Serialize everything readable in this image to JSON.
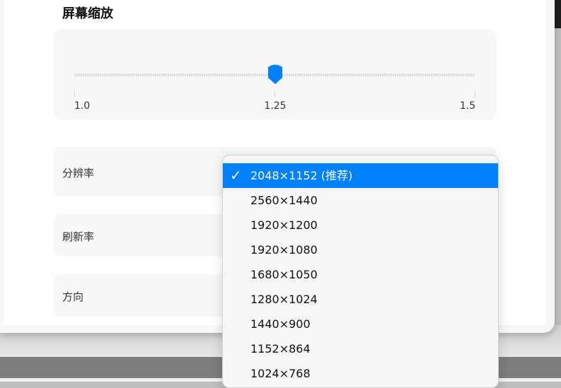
{
  "section_title": "屏幕缩放",
  "scale": {
    "min_label": "1.0",
    "mid_label": "1.25",
    "max_label": "1.5",
    "min": 1.0,
    "max": 1.5,
    "value": 1.25
  },
  "rows": [
    {
      "label": "分辨率"
    },
    {
      "label": "刷新率"
    },
    {
      "label": "方向"
    }
  ],
  "resolution_options": [
    {
      "label": "2048×1152 (推荐)",
      "selected": true
    },
    {
      "label": "2560×1440"
    },
    {
      "label": "1920×1200"
    },
    {
      "label": "1920×1080"
    },
    {
      "label": "1680×1050"
    },
    {
      "label": "1280×1024"
    },
    {
      "label": "1440×900"
    },
    {
      "label": "1152×864"
    },
    {
      "label": "1024×768"
    }
  ],
  "colors": {
    "accent": "#0081ff"
  }
}
